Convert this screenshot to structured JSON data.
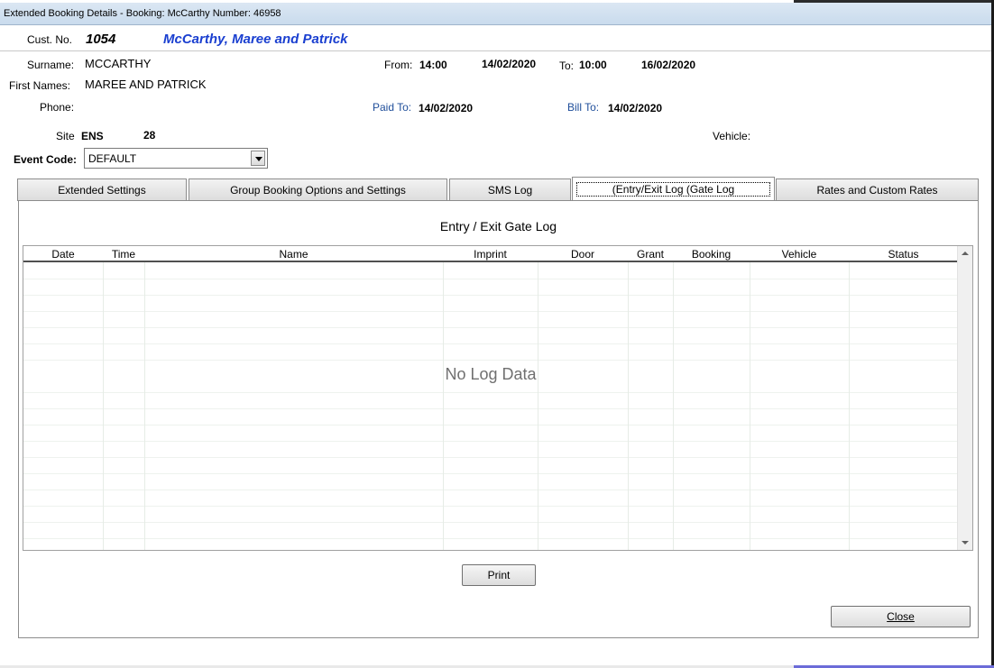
{
  "window": {
    "title": "Extended Booking Details - Booking: McCarthy Number: 46958"
  },
  "header": {
    "cust_no_label": "Cust. No.",
    "cust_no": "1054",
    "cust_name": "McCarthy, Maree and Patrick"
  },
  "details": {
    "surname_label": "Surname:",
    "surname": "MCCARTHY",
    "first_names_label": "First Names:",
    "first_names": "MAREE AND PATRICK",
    "phone_label": "Phone:",
    "from_label": "From:",
    "from_time": "14:00",
    "from_date": "14/02/2020",
    "to_label": "To:",
    "to_time": "10:00",
    "to_date": "16/02/2020",
    "paid_to_label": "Paid To:",
    "paid_to": "14/02/2020",
    "bill_to_label": "Bill To:",
    "bill_to": "14/02/2020",
    "site_label": "Site",
    "site_code": "ENS",
    "site_number": "28",
    "vehicle_label": "Vehicle:",
    "event_code_label": "Event Code:",
    "event_code": "DEFAULT"
  },
  "tabs": [
    {
      "label": "Extended Settings"
    },
    {
      "label": "Group Booking Options and Settings"
    },
    {
      "label": "SMS Log"
    },
    {
      "label": "(Entry/Exit Log (Gate Log"
    },
    {
      "label": "Rates and Custom Rates"
    }
  ],
  "log": {
    "title": "Entry / Exit Gate Log",
    "columns": [
      "Date",
      "Time",
      "Name",
      "Imprint",
      "Door",
      "Grant",
      "Booking",
      "Vehicle",
      "Status"
    ],
    "empty_text": "No Log Data"
  },
  "buttons": {
    "print": "Print",
    "close": "Close"
  }
}
